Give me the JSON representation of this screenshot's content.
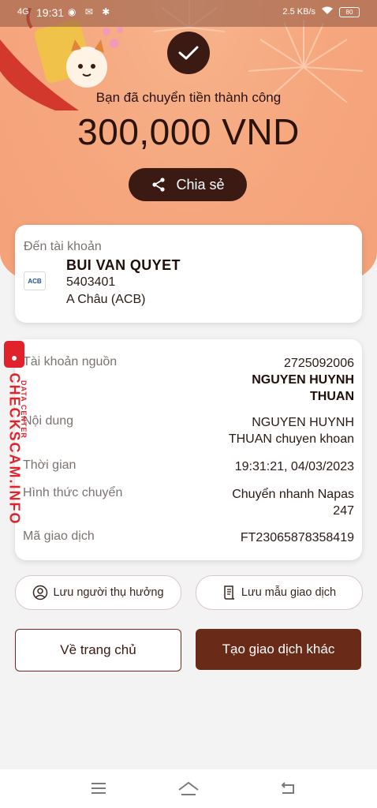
{
  "status_bar": {
    "signal": "4G",
    "time": "19:31",
    "speed": "2.5 KB/s",
    "battery": "80"
  },
  "header": {
    "success_message": "Bạn đã chuyển tiền thành công",
    "amount": "300,000 VND",
    "share_label": "Chia sẻ"
  },
  "destination": {
    "label": "Đến tài khoản",
    "bank_logo": "ACB",
    "name": "BUI VAN QUYET",
    "account_number": "5403401",
    "bank_name": "A Châu (ACB)"
  },
  "details": {
    "source_label": "Tài khoản nguồn",
    "source_account": "2725092006",
    "source_name_line1": "NGUYEN HUYNH",
    "source_name_line2": "THUAN",
    "content_label": "Nội dung",
    "content_line1": "NGUYEN HUYNH",
    "content_line2": "THUAN chuyen khoan",
    "time_label": "Thời gian",
    "time_value": "19:31:21, 04/03/2023",
    "method_label": "Hình thức chuyển",
    "method_line1": "Chuyển nhanh Napas",
    "method_line2": "247",
    "txn_label": "Mã giao dịch",
    "txn_value": "FT23065878358419"
  },
  "watermark": {
    "main": "CHECKSCAM.INFO",
    "sub": "DATA CENTER"
  },
  "actions": {
    "save_beneficiary": "Lưu người thụ hưởng",
    "save_template": "Lưu mẫu giao dịch",
    "home": "Về trang chủ",
    "new_transaction": "Tạo giao dịch khác"
  },
  "colors": {
    "hero": "#f6a67d",
    "dark_brown": "#3b1a14",
    "primary_button": "#6a2a18",
    "watermark_red": "#e0222b"
  }
}
